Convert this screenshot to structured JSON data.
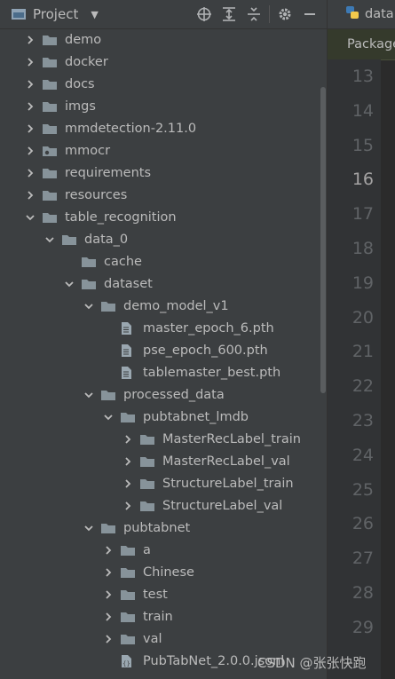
{
  "toolbar": {
    "title": "Project",
    "dropdown_icon": "caret-down",
    "icons": [
      "locate-icon",
      "expand-all-icon",
      "collapse-all-icon",
      "gear-icon",
      "hide-icon"
    ]
  },
  "tree": [
    {
      "label": "demo",
      "depth": 0,
      "expand": "collapsed",
      "icon": "folder"
    },
    {
      "label": "docker",
      "depth": 0,
      "expand": "collapsed",
      "icon": "folder"
    },
    {
      "label": "docs",
      "depth": 0,
      "expand": "collapsed",
      "icon": "folder"
    },
    {
      "label": "imgs",
      "depth": 0,
      "expand": "collapsed",
      "icon": "folder"
    },
    {
      "label": "mmdetection-2.11.0",
      "depth": 0,
      "expand": "collapsed",
      "icon": "folder"
    },
    {
      "label": "mmocr",
      "depth": 0,
      "expand": "collapsed",
      "icon": "package-folder"
    },
    {
      "label": "requirements",
      "depth": 0,
      "expand": "collapsed",
      "icon": "folder"
    },
    {
      "label": "resources",
      "depth": 0,
      "expand": "collapsed",
      "icon": "folder"
    },
    {
      "label": "table_recognition",
      "depth": 0,
      "expand": "expanded",
      "icon": "folder"
    },
    {
      "label": "data_0",
      "depth": 1,
      "expand": "expanded",
      "icon": "folder"
    },
    {
      "label": "cache",
      "depth": 2,
      "expand": "none",
      "icon": "folder"
    },
    {
      "label": "dataset",
      "depth": 2,
      "expand": "expanded",
      "icon": "folder"
    },
    {
      "label": "demo_model_v1",
      "depth": 3,
      "expand": "expanded",
      "icon": "folder"
    },
    {
      "label": "master_epoch_6.pth",
      "depth": 4,
      "expand": "none",
      "icon": "file"
    },
    {
      "label": "pse_epoch_600.pth",
      "depth": 4,
      "expand": "none",
      "icon": "file"
    },
    {
      "label": "tablemaster_best.pth",
      "depth": 4,
      "expand": "none",
      "icon": "file"
    },
    {
      "label": "processed_data",
      "depth": 3,
      "expand": "expanded",
      "icon": "folder"
    },
    {
      "label": "pubtabnet_lmdb",
      "depth": 4,
      "expand": "expanded",
      "icon": "folder"
    },
    {
      "label": "MasterRecLabel_train",
      "depth": 5,
      "expand": "collapsed",
      "icon": "folder"
    },
    {
      "label": "MasterRecLabel_val",
      "depth": 5,
      "expand": "collapsed",
      "icon": "folder"
    },
    {
      "label": "StructureLabel_train",
      "depth": 5,
      "expand": "collapsed",
      "icon": "folder"
    },
    {
      "label": "StructureLabel_val",
      "depth": 5,
      "expand": "collapsed",
      "icon": "folder"
    },
    {
      "label": "pubtabnet",
      "depth": 3,
      "expand": "expanded",
      "icon": "folder"
    },
    {
      "label": "a",
      "depth": 4,
      "expand": "collapsed",
      "icon": "folder"
    },
    {
      "label": "Chinese",
      "depth": 4,
      "expand": "collapsed",
      "icon": "folder"
    },
    {
      "label": "test",
      "depth": 4,
      "expand": "collapsed",
      "icon": "folder"
    },
    {
      "label": "train",
      "depth": 4,
      "expand": "collapsed",
      "icon": "folder"
    },
    {
      "label": "val",
      "depth": 4,
      "expand": "collapsed",
      "icon": "folder"
    },
    {
      "label": "PubTabNet_2.0.0.jsonl",
      "depth": 4,
      "expand": "none",
      "icon": "file-json"
    }
  ],
  "editor": {
    "tab_label": "data",
    "tab_icon": "python-file-icon",
    "breadcrumb": "Package",
    "line_numbers": [
      "13",
      "14",
      "15",
      "16",
      "17",
      "18",
      "19",
      "20",
      "21",
      "22",
      "23",
      "24",
      "25",
      "26",
      "27",
      "28",
      "29"
    ],
    "current_line": "16"
  },
  "watermark": "CSDN @张张快跑",
  "colors": {
    "background": "#3c3f41",
    "editor": "#2b2b2b",
    "text": "#bbbbbb",
    "folder": "#87939a"
  }
}
